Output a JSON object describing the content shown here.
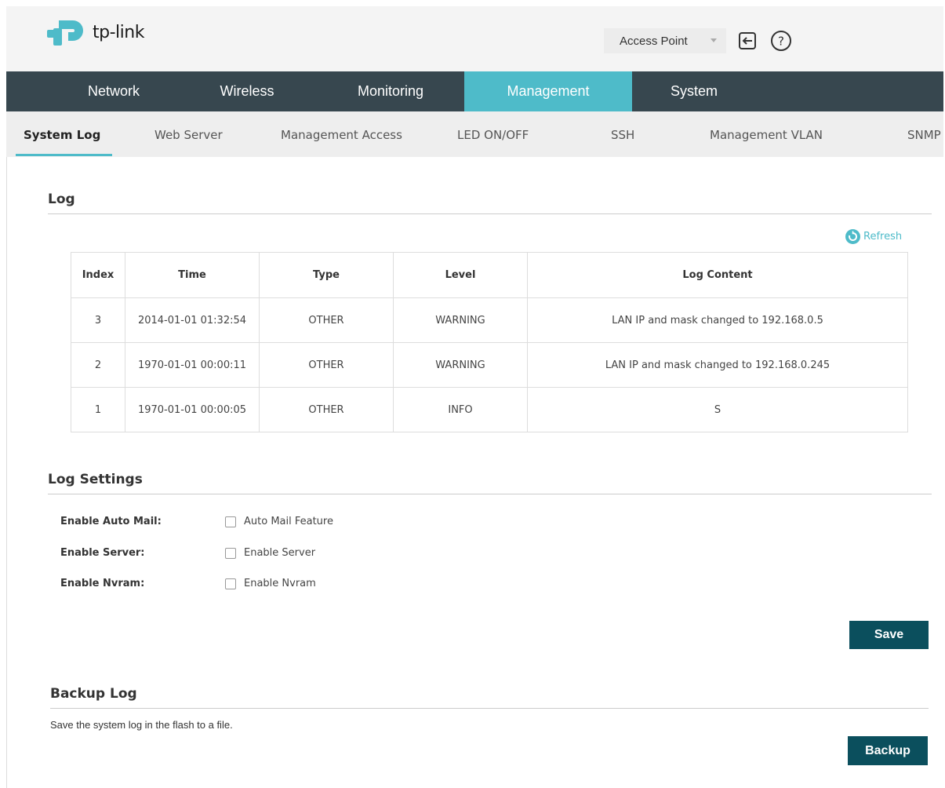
{
  "header": {
    "logo_text": "tp-link",
    "mode_select": "Access Point"
  },
  "mainnav": {
    "tabs": [
      "Network",
      "Wireless",
      "Monitoring",
      "Management",
      "System"
    ],
    "active": "Management"
  },
  "subnav": {
    "items": [
      "System Log",
      "Web Server",
      "Management Access",
      "LED ON/OFF",
      "SSH",
      "Management VLAN",
      "SNMP"
    ],
    "active": "System Log"
  },
  "log": {
    "title": "Log",
    "refresh_label": "Refresh",
    "columns": [
      "Index",
      "Time",
      "Type",
      "Level",
      "Log Content"
    ],
    "rows": [
      [
        "3",
        "2014-01-01 01:32:54",
        "OTHER",
        "WARNING",
        "LAN IP and mask changed to 192.168.0.5"
      ],
      [
        "2",
        "1970-01-01 00:00:11",
        "OTHER",
        "WARNING",
        "LAN IP and mask changed to 192.168.0.245"
      ],
      [
        "1",
        "1970-01-01 00:00:05",
        "OTHER",
        "INFO",
        "S"
      ]
    ]
  },
  "log_settings": {
    "title": "Log Settings",
    "fields": [
      {
        "label": "Enable Auto Mail:",
        "option": "Auto Mail Feature"
      },
      {
        "label": "Enable Server:",
        "option": "Enable Server"
      },
      {
        "label": "Enable Nvram:",
        "option": "Enable Nvram"
      }
    ],
    "save_label": "Save"
  },
  "backup": {
    "title": "Backup Log",
    "description": "Save the system log in the flash to a file.",
    "button_label": "Backup"
  },
  "colors": {
    "accent": "#4ebbc9",
    "nav_bg": "#37474f",
    "button_bg": "#0b4f5d"
  }
}
